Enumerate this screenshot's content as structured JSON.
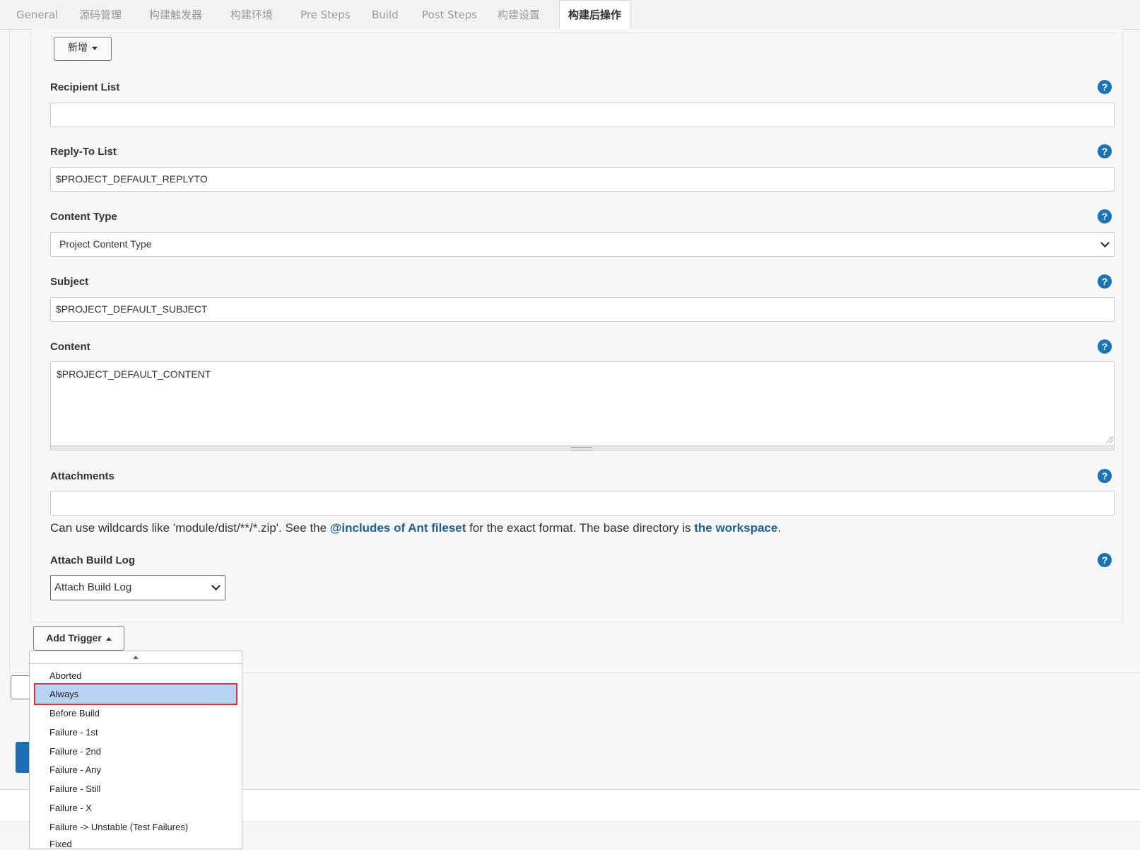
{
  "tabs": [
    {
      "label": "General"
    },
    {
      "label": "源码管理"
    },
    {
      "label": "构建触发器"
    },
    {
      "label": "构建环境"
    },
    {
      "label": "Pre Steps"
    },
    {
      "label": "Build"
    },
    {
      "label": "Post Steps"
    },
    {
      "label": "构建设置"
    },
    {
      "label": "构建后操作",
      "active": true
    }
  ],
  "add_button": {
    "label": "新增"
  },
  "fields": {
    "recipient_list": {
      "label": "Recipient List",
      "value": ""
    },
    "reply_to_list": {
      "label": "Reply-To List",
      "value": "$PROJECT_DEFAULT_REPLYTO"
    },
    "content_type": {
      "label": "Content Type",
      "value": "Project Content Type"
    },
    "subject": {
      "label": "Subject",
      "value": "$PROJECT_DEFAULT_SUBJECT"
    },
    "content": {
      "label": "Content",
      "value": "$PROJECT_DEFAULT_CONTENT"
    },
    "attachments": {
      "label": "Attachments",
      "value": ""
    },
    "attach_build_log": {
      "label": "Attach Build Log",
      "value": "Attach Build Log"
    }
  },
  "attachments_hint": {
    "prefix": "Can use wildcards like 'module/dist/**/*.zip'. See the ",
    "link1": "@includes of Ant fileset",
    "middle": " for the exact format. The base directory is ",
    "link2": "the workspace",
    "suffix": "."
  },
  "help_glyph": "?",
  "add_trigger": {
    "label": "Add Trigger"
  },
  "trigger_menu": {
    "items": [
      {
        "label": "Aborted"
      },
      {
        "label": "Always",
        "selected": true
      },
      {
        "label": "Before Build"
      },
      {
        "label": "Failure - 1st"
      },
      {
        "label": "Failure - 2nd"
      },
      {
        "label": "Failure - Any"
      },
      {
        "label": "Failure - Still"
      },
      {
        "label": "Failure - X"
      },
      {
        "label": "Failure -> Unstable (Test Failures)"
      },
      {
        "label": "Fixed"
      }
    ]
  },
  "colors": {
    "accent": "#1a73b6",
    "link": "#1a5f96",
    "selected_bg": "#b7d4f7",
    "highlight_border": "#e0313b",
    "save_button": "#1c6fb5"
  }
}
